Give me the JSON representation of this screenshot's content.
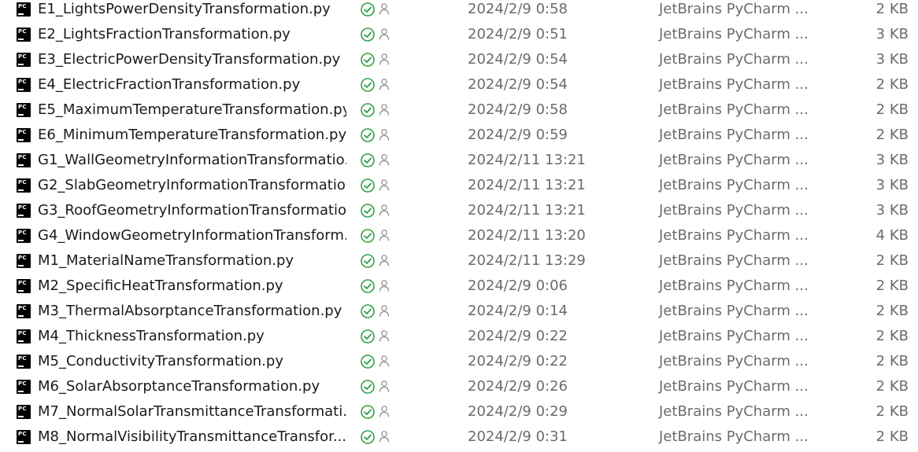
{
  "colors": {
    "status_green": "#2ea043",
    "text_primary": "#1a1a1a",
    "text_secondary": "#6b6b6b"
  },
  "icons": {
    "file": "pycharm-file-icon",
    "status": "synced-check-icon",
    "sharing": "person-icon"
  },
  "files": [
    {
      "name": "E1_LightsPowerDensityTransformation.py",
      "date": "2024/2/9 0:58",
      "type": "JetBrains PyCharm ...",
      "size": "2 KB"
    },
    {
      "name": "E2_LightsFractionTransformation.py",
      "date": "2024/2/9 0:51",
      "type": "JetBrains PyCharm ...",
      "size": "3 KB"
    },
    {
      "name": "E3_ElectricPowerDensityTransformation.py",
      "date": "2024/2/9 0:54",
      "type": "JetBrains PyCharm ...",
      "size": "3 KB"
    },
    {
      "name": "E4_ElectricFractionTransformation.py",
      "date": "2024/2/9 0:54",
      "type": "JetBrains PyCharm ...",
      "size": "2 KB"
    },
    {
      "name": "E5_MaximumTemperatureTransformation.py",
      "date": "2024/2/9 0:58",
      "type": "JetBrains PyCharm ...",
      "size": "2 KB"
    },
    {
      "name": "E6_MinimumTemperatureTransformation.py",
      "date": "2024/2/9 0:59",
      "type": "JetBrains PyCharm ...",
      "size": "2 KB"
    },
    {
      "name": "G1_WallGeometryInformationTransformatio...",
      "date": "2024/2/11 13:21",
      "type": "JetBrains PyCharm ...",
      "size": "3 KB"
    },
    {
      "name": "G2_SlabGeometryInformationTransformatio...",
      "date": "2024/2/11 13:21",
      "type": "JetBrains PyCharm ...",
      "size": "3 KB"
    },
    {
      "name": "G3_RoofGeometryInformationTransformatio...",
      "date": "2024/2/11 13:21",
      "type": "JetBrains PyCharm ...",
      "size": "3 KB"
    },
    {
      "name": "G4_WindowGeometryInformationTransform...",
      "date": "2024/2/11 13:20",
      "type": "JetBrains PyCharm ...",
      "size": "4 KB"
    },
    {
      "name": "M1_MaterialNameTransformation.py",
      "date": "2024/2/11 13:29",
      "type": "JetBrains PyCharm ...",
      "size": "2 KB"
    },
    {
      "name": "M2_SpecificHeatTransformation.py",
      "date": "2024/2/9 0:06",
      "type": "JetBrains PyCharm ...",
      "size": "2 KB"
    },
    {
      "name": "M3_ThermalAbsorptanceTransformation.py",
      "date": "2024/2/9 0:14",
      "type": "JetBrains PyCharm ...",
      "size": "2 KB"
    },
    {
      "name": "M4_ThicknessTransformation.py",
      "date": "2024/2/9 0:22",
      "type": "JetBrains PyCharm ...",
      "size": "2 KB"
    },
    {
      "name": "M5_ConductivityTransformation.py",
      "date": "2024/2/9 0:22",
      "type": "JetBrains PyCharm ...",
      "size": "2 KB"
    },
    {
      "name": "M6_SolarAbsorptanceTransformation.py",
      "date": "2024/2/9 0:26",
      "type": "JetBrains PyCharm ...",
      "size": "2 KB"
    },
    {
      "name": "M7_NormalSolarTransmittanceTransformati...",
      "date": "2024/2/9 0:29",
      "type": "JetBrains PyCharm ...",
      "size": "2 KB"
    },
    {
      "name": "M8_NormalVisibilityTransmittanceTransfor...",
      "date": "2024/2/9 0:31",
      "type": "JetBrains PyCharm ...",
      "size": "2 KB"
    }
  ]
}
